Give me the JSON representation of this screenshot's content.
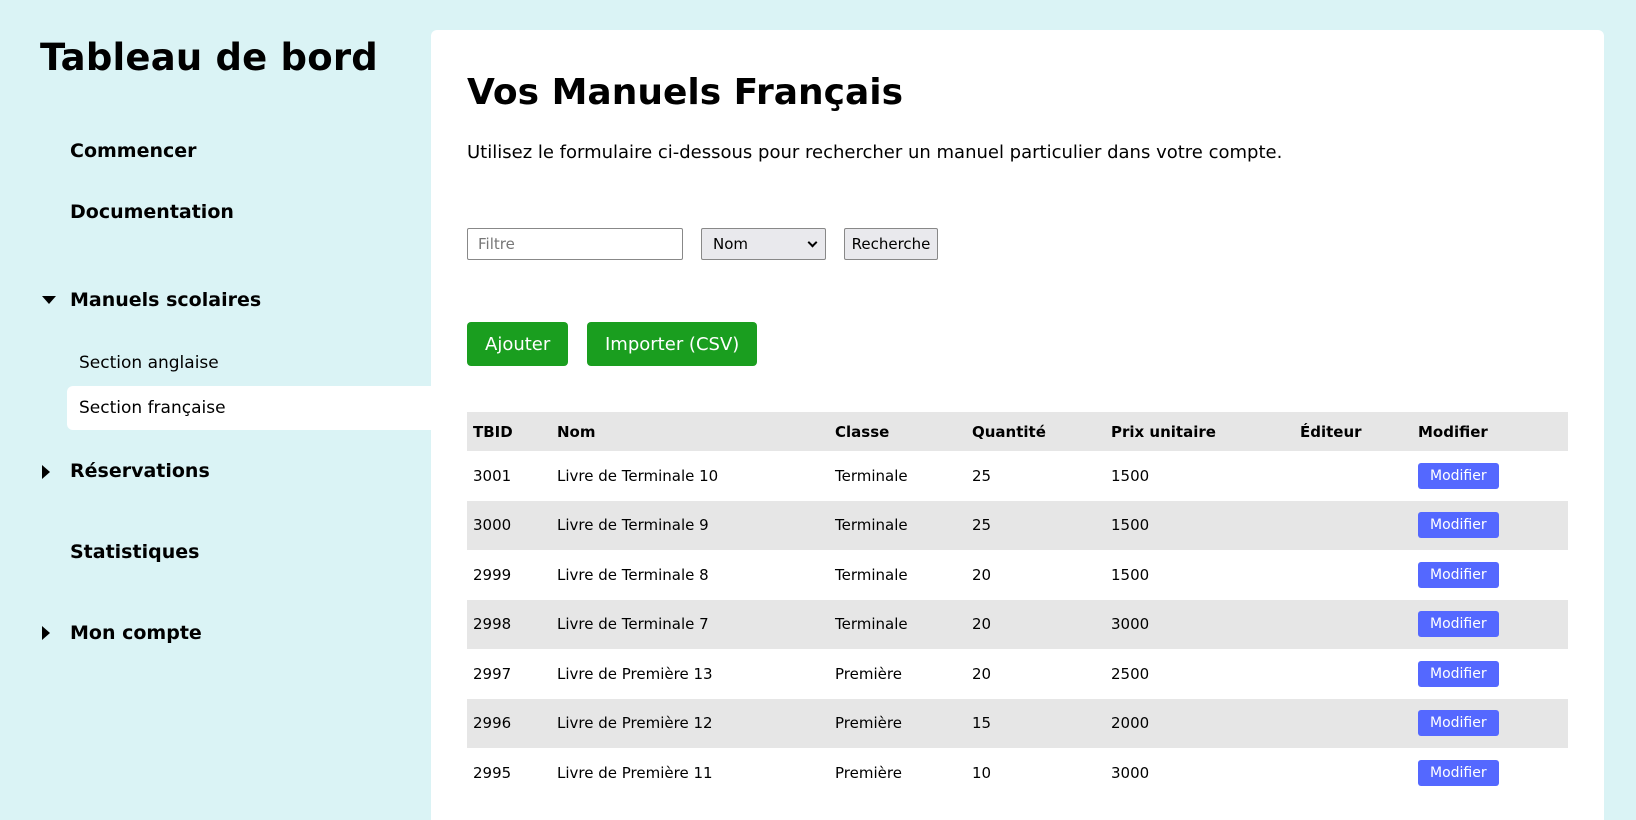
{
  "sidebar": {
    "title": "Tableau de bord",
    "items": [
      {
        "label": "Commencer"
      },
      {
        "label": "Documentation"
      },
      {
        "label": "Manuels scolaires"
      },
      {
        "label": "Réservations"
      },
      {
        "label": "Statistiques"
      },
      {
        "label": "Mon compte"
      }
    ],
    "subitems": [
      {
        "label": "Section anglaise"
      },
      {
        "label": "Section française"
      }
    ]
  },
  "main": {
    "title": "Vos Manuels Français",
    "description": "Utilisez le formulaire ci-dessous pour rechercher un manuel particulier dans votre compte.",
    "filter": {
      "placeholder": "Filtre",
      "value": "",
      "select_value": "Nom",
      "search_label": "Recherche"
    },
    "actions": {
      "add_label": "Ajouter",
      "import_label": "Importer (CSV)"
    },
    "table": {
      "headers": [
        "TBID",
        "Nom",
        "Classe",
        "Quantité",
        "Prix unitaire",
        "Éditeur",
        "Modifier"
      ],
      "edit_label": "Modifier",
      "rows": [
        {
          "tbid": "3001",
          "nom": "Livre de Terminale 10",
          "classe": "Terminale",
          "quantite": "25",
          "prix": "1500",
          "editeur": ""
        },
        {
          "tbid": "3000",
          "nom": "Livre de Terminale 9",
          "classe": "Terminale",
          "quantite": "25",
          "prix": "1500",
          "editeur": ""
        },
        {
          "tbid": "2999",
          "nom": "Livre de Terminale 8",
          "classe": "Terminale",
          "quantite": "20",
          "prix": "1500",
          "editeur": ""
        },
        {
          "tbid": "2998",
          "nom": "Livre de Terminale 7",
          "classe": "Terminale",
          "quantite": "20",
          "prix": "3000",
          "editeur": ""
        },
        {
          "tbid": "2997",
          "nom": "Livre de Première 13",
          "classe": "Première",
          "quantite": "20",
          "prix": "2500",
          "editeur": ""
        },
        {
          "tbid": "2996",
          "nom": "Livre de Première 12",
          "classe": "Première",
          "quantite": "15",
          "prix": "2000",
          "editeur": ""
        },
        {
          "tbid": "2995",
          "nom": "Livre de Première 11",
          "classe": "Première",
          "quantite": "10",
          "prix": "3000",
          "editeur": ""
        }
      ]
    }
  },
  "colors": {
    "background": "#daf3f5",
    "accent_green": "#1a9e1f",
    "edit_button": "#5468ff",
    "row_stripe": "#e6e6e6"
  },
  "icons": {
    "expanded": "caret-down-icon",
    "collapsed": "caret-right-icon"
  }
}
